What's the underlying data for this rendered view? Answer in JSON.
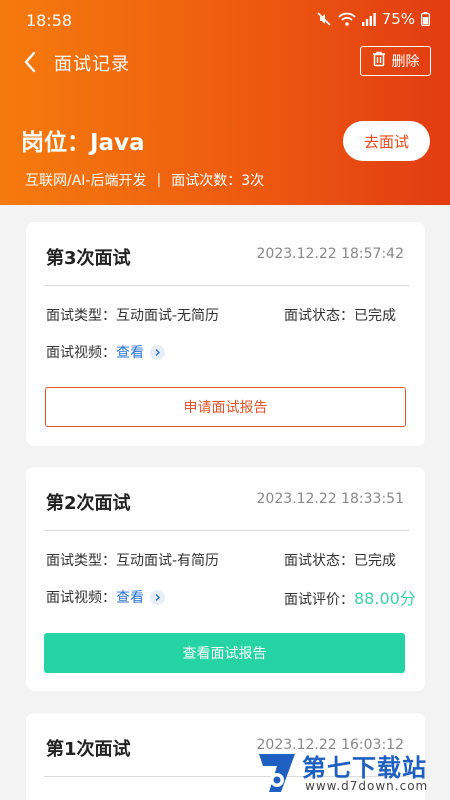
{
  "status": {
    "time": "18:58",
    "battery": "75%"
  },
  "nav": {
    "title": "面试记录",
    "delete_label": "删除"
  },
  "job": {
    "title": "岗位：Java",
    "category": "互联网/AI-后端开发",
    "separator": "|",
    "count": "面试次数：3次",
    "go_label": "去面试"
  },
  "cards": [
    {
      "title": "第3次面试",
      "time": "2023.12.22 18:57:42",
      "type_label": "面试类型：",
      "type_value": "互动面试-无简历",
      "status_label": "面试状态：",
      "status_value": "已完成",
      "video_label": "面试视频：",
      "video_link": "查看",
      "button": "申请面试报告"
    },
    {
      "title": "第2次面试",
      "time": "2023.12.22 18:33:51",
      "type_label": "面试类型：",
      "type_value": "互动面试-有简历",
      "status_label": "面试状态：",
      "status_value": "已完成",
      "video_label": "面试视频：",
      "video_link": "查看",
      "score_label": "面试评价：",
      "score_value": "88.00分",
      "button": "查看面试报告"
    },
    {
      "title": "第1次面试",
      "time": "2023.12.22 16:03:12"
    }
  ],
  "watermark": {
    "name": "第七下载站",
    "url": "www.d7down.com"
  },
  "colors": {
    "header_start": "#f57b0d",
    "header_end": "#e13c12",
    "accent": "#e3552a",
    "success": "#26d3a5",
    "score": "#3fcfa9",
    "link": "#2b73d4"
  }
}
